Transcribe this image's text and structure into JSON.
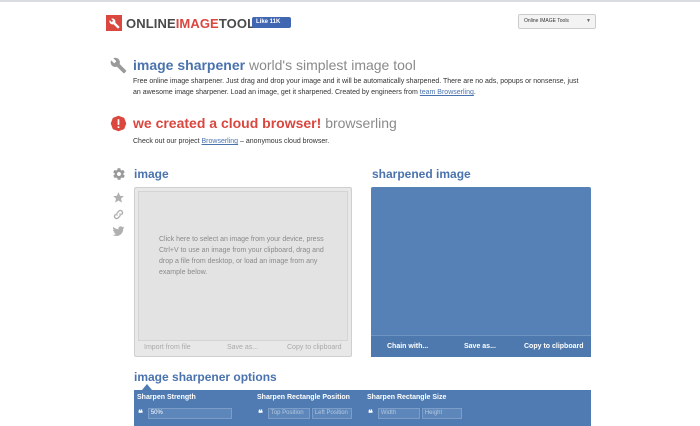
{
  "header": {
    "logo_part1": "ONLINE",
    "logo_part2": "IMAGE",
    "logo_part3": "TOOLS",
    "fb_like_label": "Like 11K",
    "tool_select_value": "Online IMAGE Tools"
  },
  "intro": {
    "title_main": "image sharpener",
    "title_sub": "world's simplest image tool",
    "description": "Free online image sharpener. Just drag and drop your image and it will be automatically sharpened. There are no ads, popups or nonsense, just an awesome image sharpener. Load an image, get it sharpened. Created by engineers from",
    "link_text": "team Browserling",
    "description_end": "."
  },
  "promo": {
    "title_main": "we created a cloud browser!",
    "title_sub": "browserling",
    "text_before": "Check out our project",
    "link_text": "Browserling",
    "text_after": "– anonymous cloud browser."
  },
  "input_panel": {
    "title": "image",
    "placeholder": "Click here to select an image from your device, press Ctrl+V to use an image from your clipboard, drag and drop a file from desktop, or load an image from any example below.",
    "actions": [
      "Import from file",
      "Save as...",
      "Copy to clipboard"
    ]
  },
  "output_panel": {
    "title": "sharpened image",
    "actions": [
      "Chain with...",
      "Save as...",
      "Copy to clipboard"
    ]
  },
  "options": {
    "title": "image sharpener options",
    "columns": [
      {
        "label": "Sharpen Strength",
        "inputs": [
          {
            "value": "50%",
            "placeholder": ""
          }
        ]
      },
      {
        "label": "Sharpen Rectangle Position",
        "inputs": [
          {
            "value": "",
            "placeholder": "Top Position"
          },
          {
            "value": "",
            "placeholder": "Left Position"
          }
        ]
      },
      {
        "label": "Sharpen Rectangle Size",
        "inputs": [
          {
            "value": "",
            "placeholder": "Width"
          },
          {
            "value": "",
            "placeholder": "Height"
          }
        ]
      }
    ]
  },
  "colors": {
    "brand_red": "#d9473f",
    "brand_blue": "#4a73ad",
    "panel_blue": "#5581b6"
  },
  "icons": {
    "wrench": "wrench-icon",
    "alert": "alert-icon",
    "gear": "gear-icon",
    "star": "star-icon",
    "link": "link-icon",
    "twitter": "twitter-icon"
  }
}
